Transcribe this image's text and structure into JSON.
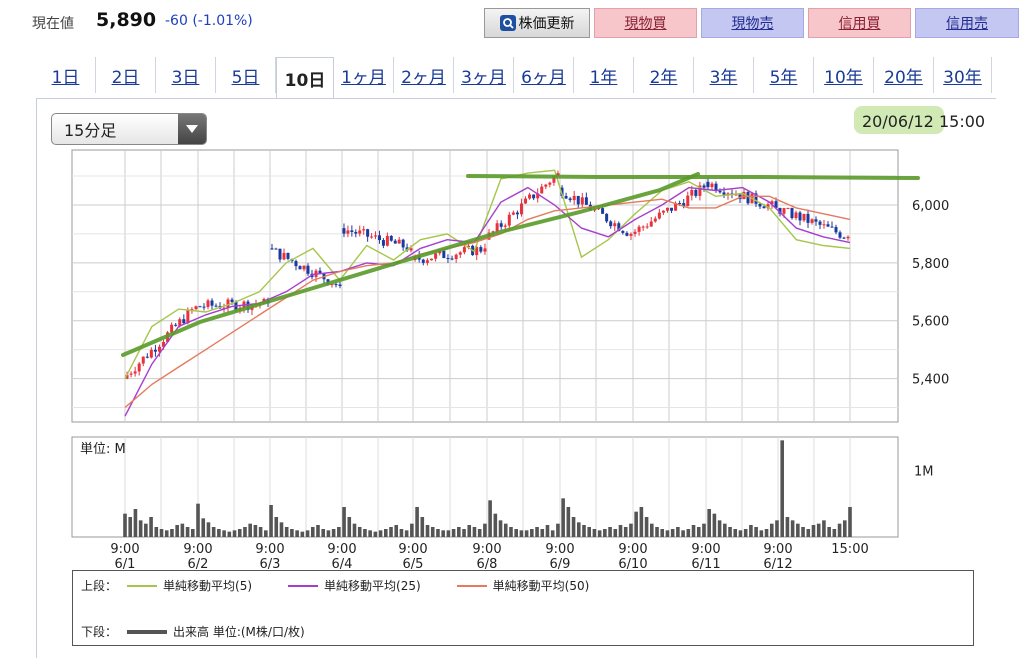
{
  "quote": {
    "label": "現在値",
    "price": "5,890",
    "change": "-60 (-1.01%)"
  },
  "buttons": {
    "refresh": "株価更新",
    "spot_buy": "現物買",
    "spot_sell": "現物売",
    "margin_buy": "信用買",
    "margin_sell": "信用売"
  },
  "tabs": [
    "1日",
    "2日",
    "3日",
    "5日",
    "10日",
    "1ヶ月",
    "2ヶ月",
    "3ヶ月",
    "6ヶ月",
    "1年",
    "2年",
    "3年",
    "5年",
    "10年",
    "20年",
    "30年"
  ],
  "active_tab": "10日",
  "interval_select": {
    "value": "15分足"
  },
  "datetime": {
    "date": "20/06/12",
    "time": "15:00"
  },
  "colors": {
    "up": "#e8323c",
    "down": "#1a3aa0",
    "ma5": "#a6c64a",
    "ma25": "#a53ecf",
    "ma50": "#e67a5e",
    "volume": "#555555",
    "annotation": "#5a9a2a",
    "highlight": "#c9e6a8"
  },
  "chart_data": [
    {
      "type": "candlestick",
      "y_ticks": [
        "6,000",
        "5,800",
        "5,600",
        "5,400"
      ],
      "y_tick_values": [
        6000,
        5800,
        5600,
        5400
      ],
      "ylim": [
        5250,
        6190
      ],
      "x_ticks": [
        {
          "time": "9:00",
          "date": "6/1"
        },
        {
          "time": "9:00",
          "date": "6/2"
        },
        {
          "time": "9:00",
          "date": "6/3"
        },
        {
          "time": "9:00",
          "date": "6/4"
        },
        {
          "time": "9:00",
          "date": "6/5"
        },
        {
          "time": "9:00",
          "date": "6/8"
        },
        {
          "time": "9:00",
          "date": "6/9"
        },
        {
          "time": "9:00",
          "date": "6/10"
        },
        {
          "time": "9:00",
          "date": "6/11"
        },
        {
          "time": "9:00",
          "date": "6/12"
        },
        {
          "time": "15:00",
          "date": ""
        }
      ],
      "series": [
        {
          "name": "単純移動平均(5)",
          "values": [
            5400,
            5580,
            5640,
            5630,
            5660,
            5700,
            5800,
            5850,
            5740,
            5860,
            5810,
            5880,
            5900,
            5840,
            6090,
            6110,
            6120,
            5820,
            5880,
            5970,
            6050,
            6080,
            6030,
            6040,
            5990,
            5880,
            5860,
            5850
          ]
        },
        {
          "name": "単純移動平均(25)",
          "values": [
            5270,
            5450,
            5580,
            5620,
            5650,
            5660,
            5700,
            5760,
            5770,
            5800,
            5790,
            5850,
            5880,
            5870,
            6010,
            6060,
            6000,
            5920,
            5890,
            5950,
            6000,
            6060,
            6050,
            6060,
            6010,
            5920,
            5890,
            5870
          ]
        },
        {
          "name": "単純移動平均(50)",
          "values": [
            5300,
            5380,
            5440,
            5500,
            5560,
            5620,
            5680,
            5740,
            5770,
            5790,
            5800,
            5830,
            5850,
            5870,
            5900,
            5950,
            5980,
            5990,
            6000,
            6010,
            6020,
            5990,
            5990,
            6030,
            6030,
            5990,
            5970,
            5950
          ]
        }
      ],
      "ohlc_by_day": [
        {
          "day": "6/1",
          "open": 5400,
          "high": 5680,
          "low": 5380,
          "close": 5650
        },
        {
          "day": "6/2",
          "open": 5650,
          "high": 5680,
          "low": 5600,
          "close": 5660
        },
        {
          "day": "6/3",
          "open": 5850,
          "high": 5870,
          "low": 5680,
          "close": 5720
        },
        {
          "day": "6/4",
          "open": 5920,
          "high": 5940,
          "low": 5760,
          "close": 5850
        },
        {
          "day": "6/5",
          "open": 5810,
          "high": 5880,
          "low": 5780,
          "close": 5850
        },
        {
          "day": "6/8",
          "open": 5880,
          "high": 6130,
          "low": 5880,
          "close": 6110
        },
        {
          "day": "6/9",
          "open": 6060,
          "high": 6080,
          "low": 5800,
          "close": 5900
        },
        {
          "day": "6/10",
          "open": 5900,
          "high": 6100,
          "low": 5890,
          "close": 6060
        },
        {
          "day": "6/11",
          "open": 6080,
          "high": 6100,
          "low": 5980,
          "close": 5990
        },
        {
          "day": "6/12",
          "open": 5990,
          "high": 5990,
          "low": 5680,
          "close": 5890
        }
      ]
    },
    {
      "type": "bar",
      "unit_label": "単位: M",
      "y_ticks": [
        "1M"
      ],
      "y_tick_values": [
        1
      ],
      "ylim": [
        0,
        1.5
      ],
      "values": [
        0.35,
        0.3,
        0.42,
        0.25,
        0.2,
        0.3,
        0.15,
        0.12,
        0.1,
        0.12,
        0.18,
        0.2,
        0.15,
        0.12,
        0.5,
        0.28,
        0.22,
        0.15,
        0.12,
        0.1,
        0.08,
        0.1,
        0.12,
        0.15,
        0.2,
        0.18,
        0.15,
        0.1,
        0.48,
        0.3,
        0.22,
        0.15,
        0.12,
        0.1,
        0.08,
        0.1,
        0.15,
        0.18,
        0.12,
        0.1,
        0.12,
        0.15,
        0.45,
        0.3,
        0.2,
        0.15,
        0.12,
        0.1,
        0.08,
        0.1,
        0.12,
        0.15,
        0.18,
        0.12,
        0.1,
        0.2,
        0.45,
        0.3,
        0.18,
        0.15,
        0.12,
        0.1,
        0.1,
        0.12,
        0.15,
        0.12,
        0.18,
        0.15,
        0.12,
        0.2,
        0.55,
        0.35,
        0.25,
        0.2,
        0.15,
        0.12,
        0.1,
        0.1,
        0.12,
        0.15,
        0.12,
        0.18,
        0.1,
        0.2,
        0.58,
        0.45,
        0.3,
        0.22,
        0.18,
        0.15,
        0.12,
        0.1,
        0.12,
        0.15,
        0.12,
        0.18,
        0.15,
        0.2,
        0.38,
        0.45,
        0.3,
        0.2,
        0.15,
        0.12,
        0.1,
        0.12,
        0.15,
        0.1,
        0.12,
        0.18,
        0.15,
        0.2,
        0.42,
        0.35,
        0.25,
        0.2,
        0.15,
        0.12,
        0.1,
        0.12,
        0.18,
        0.15,
        0.1,
        0.12,
        0.2,
        0.25,
        1.45,
        0.3,
        0.25,
        0.2,
        0.15,
        0.12,
        0.18,
        0.2,
        0.25,
        0.15,
        0.12,
        0.2,
        0.25,
        0.45
      ]
    }
  ],
  "legend": {
    "upper_label": "上段：",
    "lower_label": "下段：",
    "ma5": "単純移動平均(5)",
    "ma25": "単純移動平均(25)",
    "ma50": "単純移動平均(50)",
    "volume": "出来高 単位:(M株/口/枚)"
  }
}
